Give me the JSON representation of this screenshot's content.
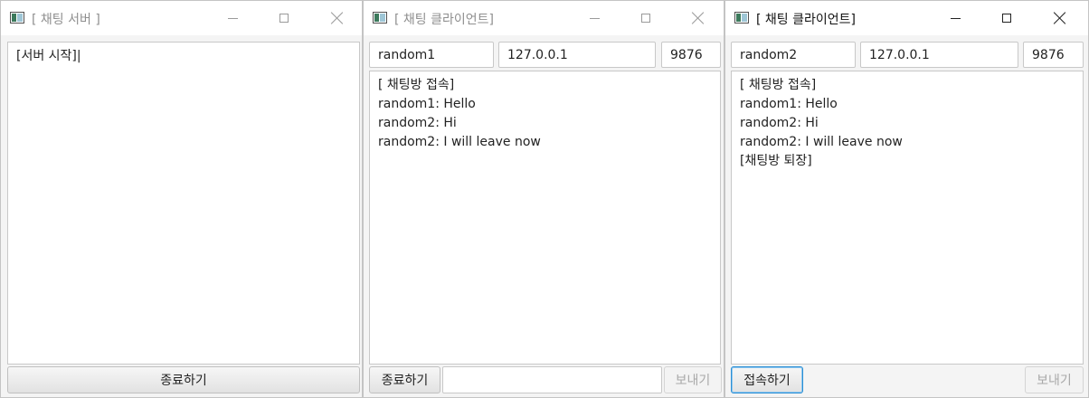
{
  "server": {
    "title": "[ 채팅 서버 ]",
    "log_lines": [
      "[서버 시작]|"
    ],
    "stop_label": "종료하기"
  },
  "client1": {
    "title": "[ 채팅 클라이언트]",
    "name": "random1",
    "host": "127.0.0.1",
    "port": "9876",
    "log_lines": [
      "[ 채팅방 접속]",
      "random1: Hello",
      "random2: Hi",
      "random2: I will leave now"
    ],
    "toggle_label": "종료하기",
    "message": "",
    "send_label": "보내기"
  },
  "client2": {
    "title": "[ 채팅 클라이언트]",
    "name": "random2",
    "host": "127.0.0.1",
    "port": "9876",
    "log_lines": [
      "[ 채팅방 접속]",
      "random1: Hello",
      "random2: Hi",
      "random2: I will leave now",
      "[채팅방 퇴장]"
    ],
    "toggle_label": "접속하기",
    "send_label": "보내기"
  }
}
